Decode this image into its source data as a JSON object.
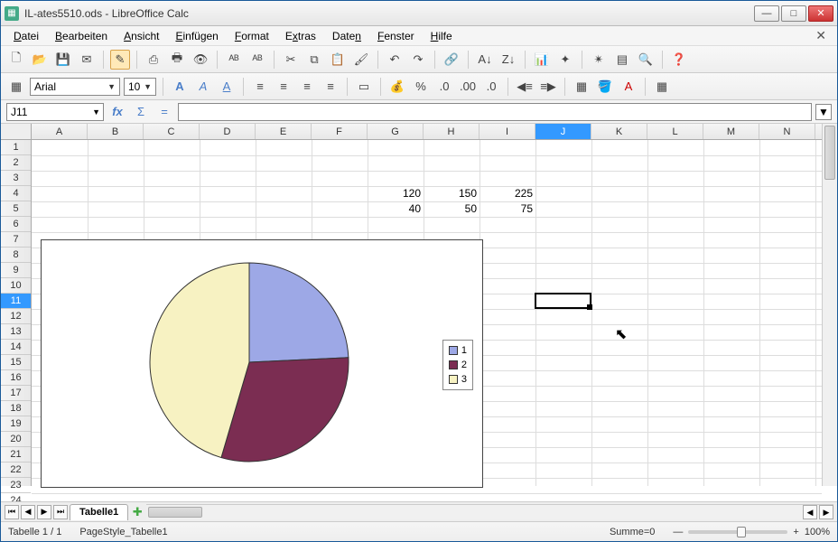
{
  "window": {
    "title": "IL-ates5510.ods - LibreOffice Calc"
  },
  "menu": {
    "items": [
      "Datei",
      "Bearbeiten",
      "Ansicht",
      "Einfügen",
      "Format",
      "Extras",
      "Daten",
      "Fenster",
      "Hilfe"
    ]
  },
  "font": {
    "name": "Arial",
    "size": "10"
  },
  "cellref": "J11",
  "columns": [
    "A",
    "B",
    "C",
    "D",
    "E",
    "F",
    "G",
    "H",
    "I",
    "J",
    "K",
    "L",
    "M",
    "N"
  ],
  "selectedCol": "J",
  "rows": 24,
  "selectedRow": 11,
  "cellData": {
    "G4": "120",
    "H4": "150",
    "I4": "225",
    "G5": "40",
    "H5": "50",
    "I5": "75"
  },
  "chart_data": {
    "type": "pie",
    "title": "",
    "series": [
      {
        "name": "1",
        "value": 120,
        "color": "#9da8e6"
      },
      {
        "name": "2",
        "value": 150,
        "color": "#7b2d52"
      },
      {
        "name": "3",
        "value": 225,
        "color": "#f7f2c2"
      }
    ],
    "legend": {
      "position": "right",
      "items": [
        "1",
        "2",
        "3"
      ]
    }
  },
  "sheet": {
    "tab": "Tabelle1"
  },
  "status": {
    "sheet": "Tabelle 1 / 1",
    "style": "PageStyle_Tabelle1",
    "sum": "Summe=0",
    "zoom": "100%"
  },
  "colors": {
    "slice1": "#9da8e6",
    "slice2": "#7b2d52",
    "slice3": "#f7f2c2"
  }
}
